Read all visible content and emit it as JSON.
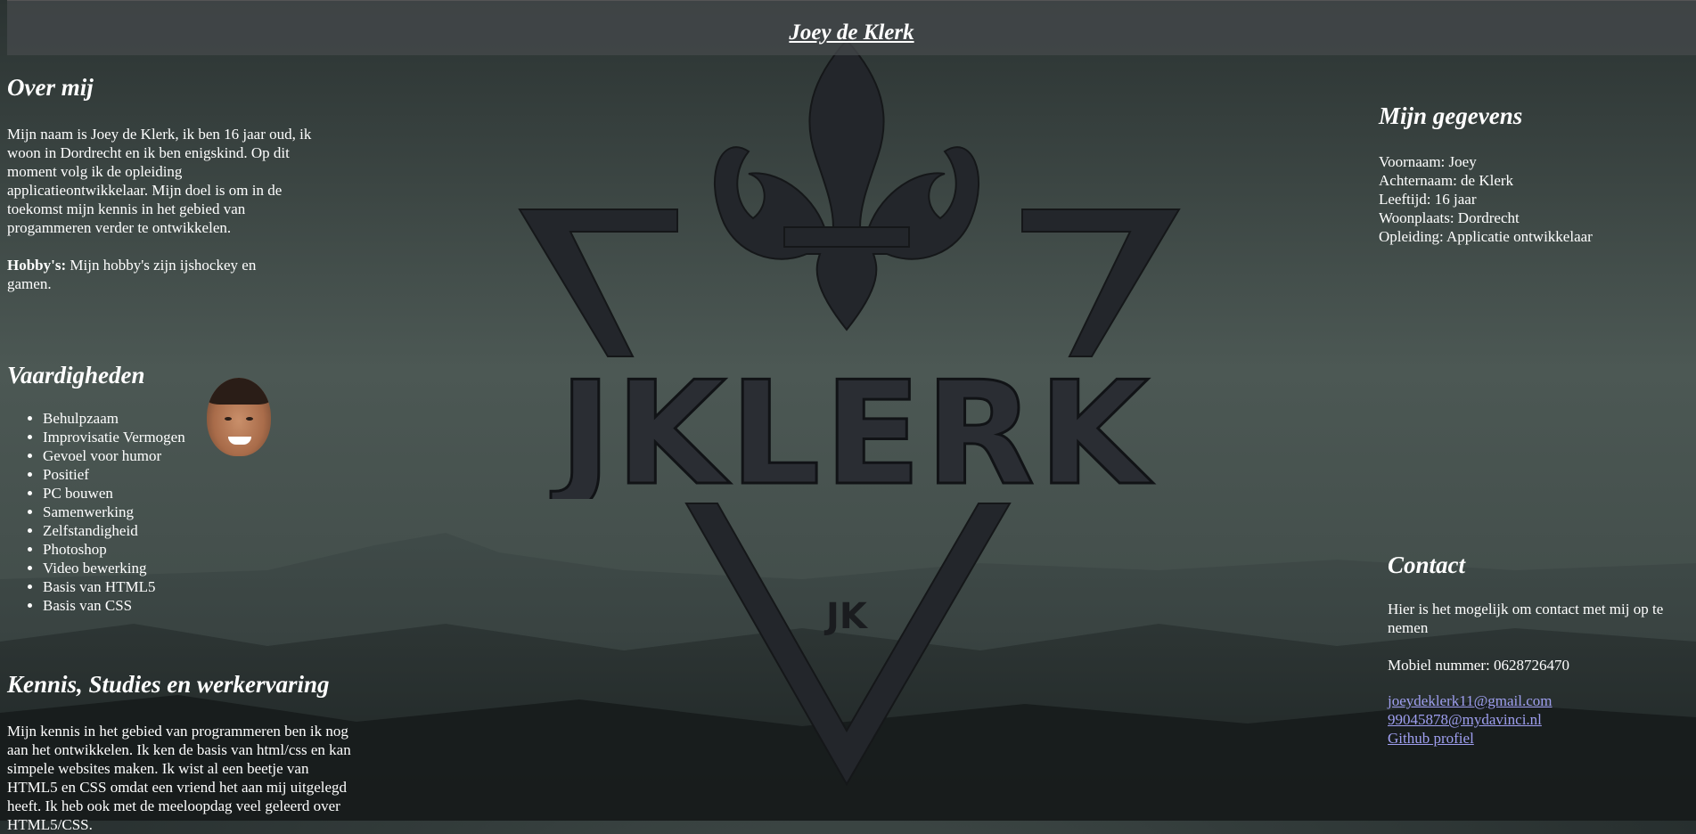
{
  "header": {
    "title": "Joey de Klerk"
  },
  "logo": {
    "text": "JKLERK",
    "mark": "JK"
  },
  "over_mij": {
    "heading": "Over mij",
    "text": "Mijn naam is Joey de Klerk, ik ben 16 jaar oud, ik woon in Dordrecht en ik ben enigskind. Op dit moment volg ik de opleiding applicatieontwikkelaar. Mijn doel is om in de toekomst mijn kennis in het gebied van progammeren verder te ontwikkelen.",
    "hobbies_label": "Hobby's:",
    "hobbies_text": " Mijn hobby's zijn ijshockey en gamen."
  },
  "vaardigheden": {
    "heading": "Vaardigheden",
    "items": [
      "Behulpzaam",
      "Improvisatie Vermogen",
      "Gevoel voor humor",
      "Positief",
      "PC bouwen",
      "Samenwerking",
      "Zelfstandigheid",
      "Photoshop",
      "Video bewerking",
      "Basis van HTML5",
      "Basis van CSS"
    ]
  },
  "kennis": {
    "heading": "Kennis, Studies en werkervaring",
    "text": "Mijn kennis in het gebied van programmeren ben ik nog aan het ontwikkelen. Ik ken de basis van html/css en kan simpele websites maken. Ik wist al een beetje van HTML5 en CSS omdat een vriend het aan mij uitgelegd heeft. Ik heb ook met de meeloopdag veel geleerd over HTML5/CSS."
  },
  "gegevens": {
    "heading": "Mijn gegevens",
    "lines": [
      "Voornaam: Joey",
      "Achternaam: de Klerk",
      "Leeftijd: 16 jaar",
      "Woonplaats: Dordrecht",
      "Opleiding: Applicatie ontwikkelaar"
    ]
  },
  "contact": {
    "heading": "Contact",
    "intro": "Hier is het mogelijk om contact met mij op te nemen",
    "phone": "Mobiel nummer: 0628726470",
    "links": [
      "joeydeklerk11@gmail.com",
      "99045878@mydavinci.nl",
      "Github profiel"
    ]
  }
}
